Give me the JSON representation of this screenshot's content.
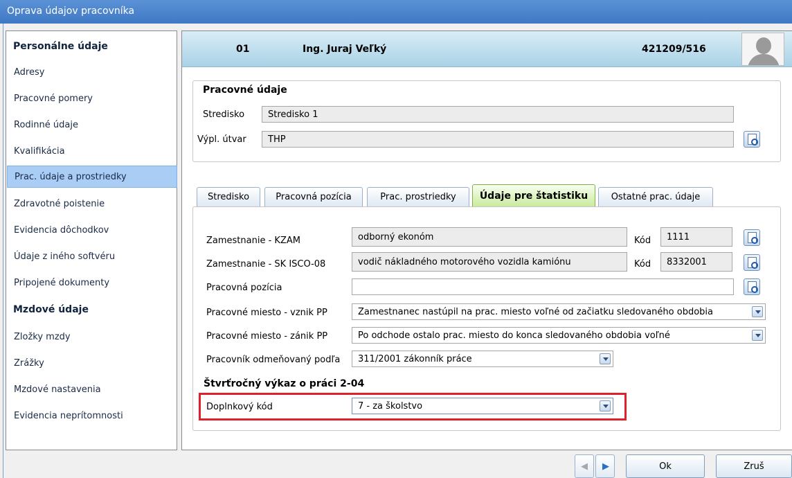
{
  "window": {
    "title": "Oprava údajov pracovníka"
  },
  "sidebar": {
    "section1": "Personálne údaje",
    "items1": [
      "Adresy",
      "Pracovné pomery",
      "Rodinné údaje",
      "Kvalifikácia",
      "Prac. údaje a prostriedky",
      "Zdravotné poistenie",
      "Evidencia dôchodkov",
      "Údaje z iného softvéru",
      "Pripojené dokumenty"
    ],
    "section2": "Mzdové údaje",
    "items2": [
      "Zložky mzdy",
      "Zrážky",
      "Mzdové nastavenia",
      "Evidencia neprítomnosti"
    ],
    "active": "Prac. údaje a prostriedky"
  },
  "header": {
    "number": "01",
    "name": "Ing. Juraj Veľký",
    "id": "421209/516",
    "avatar_icon": "user-avatar-icon"
  },
  "work": {
    "title": "Pracovné údaje",
    "stredisko_label": "Stredisko",
    "stredisko_value": "Stredisko 1",
    "utvar_label": "Výpl. útvar",
    "utvar_value": "THP"
  },
  "tabs": [
    "Stredisko",
    "Pracovná pozícia",
    "Prac. prostriedky",
    "Údaje pre štatistiku",
    "Ostatné prac. údaje"
  ],
  "active_tab": "Údaje pre štatistiku",
  "stats": {
    "kzam_label": "Zamestnanie - KZAM",
    "kzam_value": "odborný ekonóm",
    "kzam_kod_label": "Kód",
    "kzam_kod": "1111",
    "isco_label": "Zamestnanie - SK ISCO-08",
    "isco_value": "vodič nákladného motorového vozidla kamiónu",
    "isco_kod_label": "Kód",
    "isco_kod": "8332001",
    "pozicia_label": "Pracovná pozícia",
    "pozicia_value": "",
    "vznik_label": "Pracovné miesto - vznik PP",
    "vznik_value": "Zamestnanec nastúpil na prac. miesto voľné od začiatku sledovaného obdobia",
    "zanik_label": "Pracovné miesto - zánik PP",
    "zanik_value": "Po odchode ostalo prac. miesto do konca sledovaného obdobia voľné",
    "odmena_label": "Pracovník odmeňovaný podľa",
    "odmena_value": "311/2001 zákonník práce",
    "vykaz_title": "Štvrťročný výkaz o práci 2-04",
    "doplnkovy_label": "Doplnkový kód",
    "doplnkovy_value": "7 - za školstvo"
  },
  "highlight_color": "#e0202a",
  "buttons": {
    "ok": "Ok",
    "cancel": "Zruš",
    "prev_icon": "arrow-left-icon",
    "next_icon": "arrow-right-icon"
  }
}
